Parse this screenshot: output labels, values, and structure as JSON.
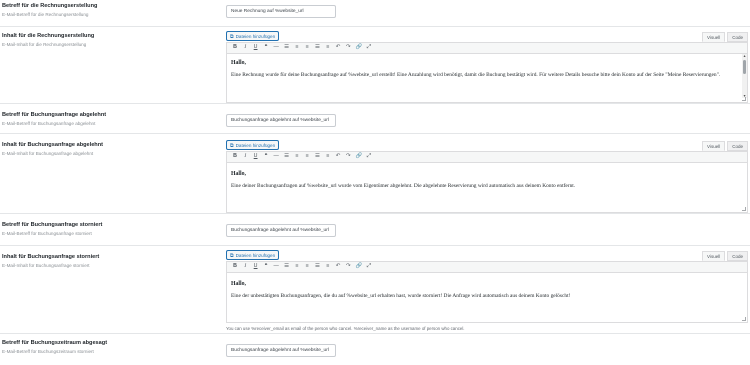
{
  "toolbar_icons": [
    {
      "name": "bold-icon",
      "glyph": "B",
      "cls": "b"
    },
    {
      "name": "italic-icon",
      "glyph": "I",
      "cls": "i"
    },
    {
      "name": "underline-icon",
      "glyph": "U",
      "cls": "u"
    },
    {
      "name": "blockquote-icon",
      "glyph": "❝",
      "cls": ""
    },
    {
      "name": "horizontal-rule-icon",
      "glyph": "—",
      "cls": ""
    },
    {
      "name": "bulleted-list-icon",
      "glyph": "☰",
      "cls": ""
    },
    {
      "name": "numbered-list-icon",
      "glyph": "≡",
      "cls": ""
    },
    {
      "name": "align-left-icon",
      "glyph": "≡",
      "cls": ""
    },
    {
      "name": "align-center-icon",
      "glyph": "☰",
      "cls": ""
    },
    {
      "name": "align-right-icon",
      "glyph": "≡",
      "cls": ""
    },
    {
      "name": "undo-icon",
      "glyph": "↶",
      "cls": ""
    },
    {
      "name": "redo-icon",
      "glyph": "↷",
      "cls": ""
    },
    {
      "name": "link-icon",
      "glyph": "🔗",
      "cls": ""
    },
    {
      "name": "fullscreen-icon",
      "glyph": "⤢",
      "cls": ""
    }
  ],
  "media_button_label": "Dateien hinzufügen",
  "tab_visual_label": "Visuell",
  "tab_code_label": "Code",
  "fields": {
    "invoice_subject": {
      "label": "Betreff für die Rechnungserstellung",
      "description": "E-Mail-Betreff für die Rechnungserstellung",
      "value": "Neue Rechnung auf %website_url"
    },
    "invoice_content": {
      "label": "Inhalt für die Rechnungserstellung",
      "description": "E-Mail-Inhalt für die Rechnungserstellung",
      "hello": "Hallo,",
      "text": "Eine Rechnung wurde für deine Buchungsanfrage auf %website_url erstellt! Eine Anzahlung wird benötigt, damit die Buchung bestätigt wird. Für weitere Details besuche bitte dein Konto auf der Seite \"Meine Reservierungen\"."
    },
    "rejected_subject": {
      "label": "Betreff für Buchungsanfrage abgelehnt",
      "description": "E-Mail-Betreff für Buchungsanfrage abgelehnt",
      "value": "Buchungsanfrage abgelehnt auf %website_url"
    },
    "rejected_content": {
      "label": "Inhalt für Buchungsanfrage abgelehnt",
      "description": "E-Mail-Inhalt für Buchungsanfrage abgelehnt",
      "hello": "Hallo,",
      "text": "Eine deiner Buchungsanfragen auf %website_url wurde vom Eigentümer abgelehnt. Die abgelehnte Reservierung wird automatisch aus deinem Konto entfernt."
    },
    "cancelled_subject": {
      "label": "Betreff für Buchungsanfrage storniert",
      "description": "E-Mail-Betreff für Buchungsanfrage storniert",
      "value": "Buchungsanfrage abgelehnt auf %website_url"
    },
    "cancelled_content": {
      "label": "Inhalt für Buchungsanfrage storniert",
      "description": "E-Mail-Inhalt für Buchungsanfrage storniert",
      "hello": "Hallo,",
      "text": "Eine der unbestätigten Buchungsanfragen, die du auf %website_url erhalten hast, wurde storniert! Die Anfrage wird automatisch aus deinem Konto gelöscht!",
      "hint": "You can use %receiver_email as email of the person who cancel. %receiver_name as the username of person who cancel."
    },
    "period_subject": {
      "label": "Betreff für Buchungszeitraum abgesagt",
      "description": "E-Mail-Betreff für Buchungszeitraum storniert",
      "value": "Buchungsanfrage abgelehnt auf %website_url"
    }
  }
}
